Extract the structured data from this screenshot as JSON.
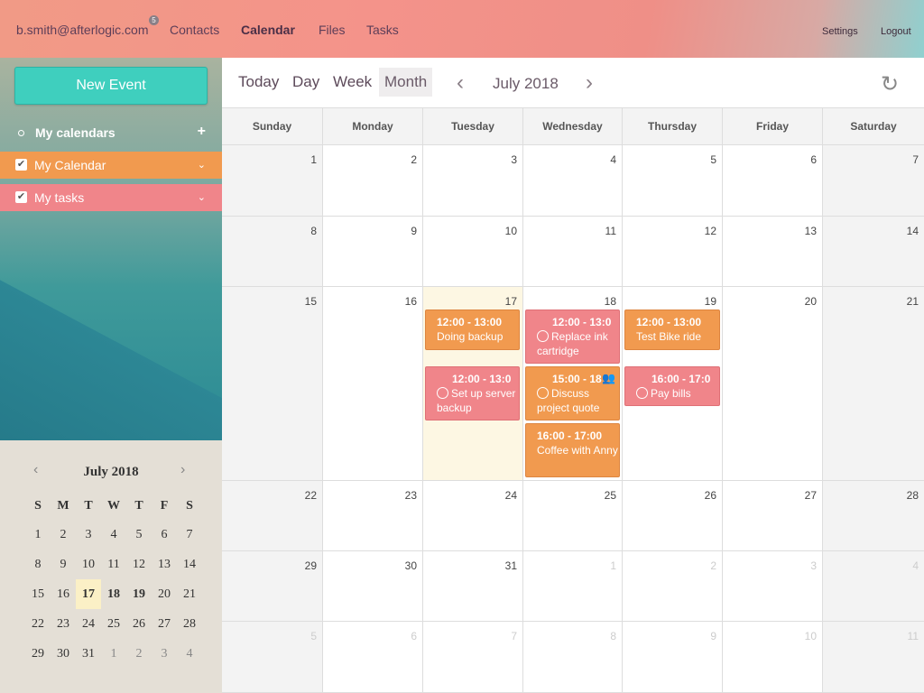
{
  "topbar": {
    "account": "b.smith@afterlogic.com",
    "badge": "5",
    "nav": [
      "Contacts",
      "Calendar",
      "Files",
      "Tasks"
    ],
    "active_nav": "Calendar",
    "settings": "Settings",
    "logout": "Logout"
  },
  "sidebar": {
    "new_event": "New Event",
    "my_calendars": "My calendars",
    "add_icon": "+",
    "calendars": [
      {
        "label": "My Calendar",
        "color": "#f19a4f"
      },
      {
        "label": "My tasks",
        "color": "#f0858a"
      }
    ]
  },
  "mini_calendar": {
    "title": "July 2018",
    "weekdays": [
      "S",
      "M",
      "T",
      "W",
      "T",
      "F",
      "S"
    ],
    "weeks": [
      [
        "1",
        "2",
        "3",
        "4",
        "5",
        "6",
        "7"
      ],
      [
        "8",
        "9",
        "10",
        "11",
        "12",
        "13",
        "14"
      ],
      [
        "15",
        "16",
        "17",
        "18",
        "19",
        "20",
        "21"
      ],
      [
        "22",
        "23",
        "24",
        "25",
        "26",
        "27",
        "28"
      ],
      [
        "29",
        "30",
        "31",
        "1",
        "2",
        "3",
        "4"
      ]
    ],
    "today": "17"
  },
  "toolbar": {
    "views": [
      "Today",
      "Day",
      "Week",
      "Month"
    ],
    "active_view": "Month",
    "period": "July 2018"
  },
  "calendar": {
    "weekdays": [
      "Sunday",
      "Monday",
      "Tuesday",
      "Wednesday",
      "Thursday",
      "Friday",
      "Saturday"
    ],
    "weeks": [
      [
        "1",
        "2",
        "3",
        "4",
        "5",
        "6",
        "7"
      ],
      [
        "8",
        "9",
        "10",
        "11",
        "12",
        "13",
        "14"
      ],
      [
        "15",
        "16",
        "17",
        "18",
        "19",
        "20",
        "21"
      ],
      [
        "22",
        "23",
        "24",
        "25",
        "26",
        "27",
        "28"
      ],
      [
        "29",
        "30",
        "31",
        "1",
        "2",
        "3",
        "4"
      ],
      [
        "5",
        "6",
        "7",
        "8",
        "9",
        "10",
        "11"
      ]
    ],
    "today_label": "17",
    "events": [
      {
        "time": "12:00 - 13:00",
        "title": "Doing backup",
        "color": "orange",
        "task": false
      },
      {
        "time": "12:00 - 13:0",
        "title": "Set up server backup",
        "color": "pink",
        "task": true
      },
      {
        "time": "12:00 - 13:0",
        "title": "Replace ink cartridge",
        "color": "pink",
        "task": true
      },
      {
        "time": "15:00 - 18",
        "title": "Discuss project quote",
        "color": "orange",
        "task": true,
        "people_icon": "people-icon"
      },
      {
        "time": "16:00 - 17:00",
        "title": "Coffee with Anny",
        "color": "orange",
        "task": false
      },
      {
        "time": "12:00 - 13:00",
        "title": "Test Bike ride",
        "color": "orange",
        "task": false
      },
      {
        "time": "16:00 - 17:0",
        "title": "Pay bills",
        "color": "pink",
        "task": true
      }
    ]
  }
}
